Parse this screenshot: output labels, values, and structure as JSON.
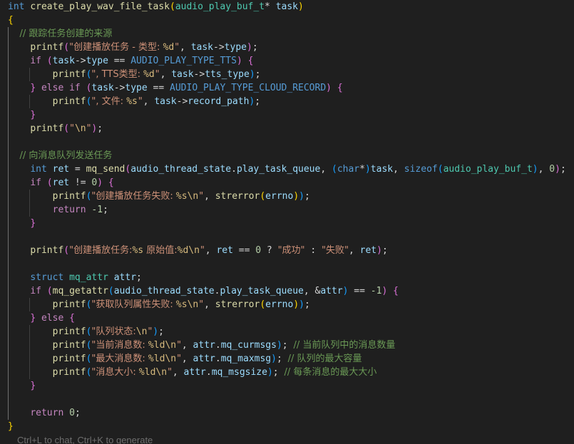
{
  "code_lines": [
    [
      [
        "int",
        "t-kw"
      ],
      [
        " ",
        "t-pun"
      ],
      [
        "create_play_wav_file_task",
        "t-fn"
      ],
      [
        "(",
        "t-b1"
      ],
      [
        "audio_play_buf_t",
        "t-type"
      ],
      [
        "* ",
        "t-pun"
      ],
      [
        "task",
        "t-var"
      ],
      [
        ")",
        "t-b1"
      ]
    ],
    [
      [
        "{",
        "t-b1"
      ]
    ],
    [
      [
        "    // 跟踪任务创建的来源",
        "t-cmt"
      ]
    ],
    [
      [
        "    ",
        "t-pun"
      ],
      [
        "printf",
        "t-fn"
      ],
      [
        "(",
        "t-b2"
      ],
      [
        "\"创建播放任务 - 类型: ",
        "t-str"
      ],
      [
        "%d",
        "t-esc"
      ],
      [
        "\"",
        "t-str"
      ],
      [
        ", ",
        "t-pun"
      ],
      [
        "task",
        "t-var"
      ],
      [
        "->",
        "t-pun"
      ],
      [
        "type",
        "t-var"
      ],
      [
        ")",
        "t-b2"
      ],
      [
        ";",
        "t-pun"
      ]
    ],
    [
      [
        "    ",
        "t-pun"
      ],
      [
        "if",
        "t-ctl"
      ],
      [
        " ",
        "t-pun"
      ],
      [
        "(",
        "t-b2"
      ],
      [
        "task",
        "t-var"
      ],
      [
        "->",
        "t-pun"
      ],
      [
        "type",
        "t-var"
      ],
      [
        " == ",
        "t-pun"
      ],
      [
        "AUDIO_PLAY_TYPE_TTS",
        "t-kw"
      ],
      [
        ")",
        "t-b2"
      ],
      [
        " ",
        "t-pun"
      ],
      [
        "{",
        "t-b2"
      ]
    ],
    [
      [
        "        ",
        "t-pun"
      ],
      [
        "printf",
        "t-fn"
      ],
      [
        "(",
        "t-b3"
      ],
      [
        "\", TTS类型: ",
        "t-str"
      ],
      [
        "%d",
        "t-esc"
      ],
      [
        "\"",
        "t-str"
      ],
      [
        ", ",
        "t-pun"
      ],
      [
        "task",
        "t-var"
      ],
      [
        "->",
        "t-pun"
      ],
      [
        "tts_type",
        "t-var"
      ],
      [
        ")",
        "t-b3"
      ],
      [
        ";",
        "t-pun"
      ]
    ],
    [
      [
        "    ",
        "t-pun"
      ],
      [
        "}",
        "t-b2"
      ],
      [
        " ",
        "t-pun"
      ],
      [
        "else",
        "t-ctl"
      ],
      [
        " ",
        "t-pun"
      ],
      [
        "if",
        "t-ctl"
      ],
      [
        " ",
        "t-pun"
      ],
      [
        "(",
        "t-b2"
      ],
      [
        "task",
        "t-var"
      ],
      [
        "->",
        "t-pun"
      ],
      [
        "type",
        "t-var"
      ],
      [
        " == ",
        "t-pun"
      ],
      [
        "AUDIO_PLAY_TYPE_CLOUD_RECORD",
        "t-kw"
      ],
      [
        ")",
        "t-b2"
      ],
      [
        " ",
        "t-pun"
      ],
      [
        "{",
        "t-b2"
      ]
    ],
    [
      [
        "        ",
        "t-pun"
      ],
      [
        "printf",
        "t-fn"
      ],
      [
        "(",
        "t-b3"
      ],
      [
        "\", 文件: ",
        "t-str"
      ],
      [
        "%s",
        "t-esc"
      ],
      [
        "\"",
        "t-str"
      ],
      [
        ", ",
        "t-pun"
      ],
      [
        "task",
        "t-var"
      ],
      [
        "->",
        "t-pun"
      ],
      [
        "record_path",
        "t-var"
      ],
      [
        ")",
        "t-b3"
      ],
      [
        ";",
        "t-pun"
      ]
    ],
    [
      [
        "    ",
        "t-pun"
      ],
      [
        "}",
        "t-b2"
      ]
    ],
    [
      [
        "    ",
        "t-pun"
      ],
      [
        "printf",
        "t-fn"
      ],
      [
        "(",
        "t-b2"
      ],
      [
        "\"",
        "t-str"
      ],
      [
        "\\n",
        "t-esc"
      ],
      [
        "\"",
        "t-str"
      ],
      [
        ")",
        "t-b2"
      ],
      [
        ";",
        "t-pun"
      ]
    ],
    [],
    [
      [
        "    // 向消息队列发送任务",
        "t-cmt"
      ]
    ],
    [
      [
        "    ",
        "t-pun"
      ],
      [
        "int",
        "t-kw"
      ],
      [
        " ",
        "t-pun"
      ],
      [
        "ret",
        "t-var"
      ],
      [
        " = ",
        "t-pun"
      ],
      [
        "mq_send",
        "t-fn"
      ],
      [
        "(",
        "t-b2"
      ],
      [
        "audio_thread_state",
        "t-var"
      ],
      [
        ".",
        "t-pun"
      ],
      [
        "play_task_queue",
        "t-var"
      ],
      [
        ", ",
        "t-pun"
      ],
      [
        "(",
        "t-b3"
      ],
      [
        "char",
        "t-kw"
      ],
      [
        "*",
        "t-pun"
      ],
      [
        ")",
        "t-b3"
      ],
      [
        "task",
        "t-var"
      ],
      [
        ", ",
        "t-pun"
      ],
      [
        "sizeof",
        "t-kw"
      ],
      [
        "(",
        "t-b3"
      ],
      [
        "audio_play_buf_t",
        "t-type"
      ],
      [
        ")",
        "t-b3"
      ],
      [
        ", ",
        "t-pun"
      ],
      [
        "0",
        "t-num"
      ],
      [
        ")",
        "t-b2"
      ],
      [
        ";",
        "t-pun"
      ]
    ],
    [
      [
        "    ",
        "t-pun"
      ],
      [
        "if",
        "t-ctl"
      ],
      [
        " ",
        "t-pun"
      ],
      [
        "(",
        "t-b2"
      ],
      [
        "ret",
        "t-var"
      ],
      [
        " != ",
        "t-pun"
      ],
      [
        "0",
        "t-num"
      ],
      [
        ")",
        "t-b2"
      ],
      [
        " ",
        "t-pun"
      ],
      [
        "{",
        "t-b2"
      ]
    ],
    [
      [
        "        ",
        "t-pun"
      ],
      [
        "printf",
        "t-fn"
      ],
      [
        "(",
        "t-b3"
      ],
      [
        "\"创建播放任务失败: ",
        "t-str"
      ],
      [
        "%s\\n",
        "t-esc"
      ],
      [
        "\"",
        "t-str"
      ],
      [
        ", ",
        "t-pun"
      ],
      [
        "strerror",
        "t-fn"
      ],
      [
        "(",
        "t-b1"
      ],
      [
        "errno",
        "t-var"
      ],
      [
        ")",
        "t-b1"
      ],
      [
        ")",
        "t-b3"
      ],
      [
        ";",
        "t-pun"
      ]
    ],
    [
      [
        "        ",
        "t-pun"
      ],
      [
        "return",
        "t-ctl"
      ],
      [
        " ",
        "t-pun"
      ],
      [
        "-1",
        "t-num"
      ],
      [
        ";",
        "t-pun"
      ]
    ],
    [
      [
        "    ",
        "t-pun"
      ],
      [
        "}",
        "t-b2"
      ]
    ],
    [],
    [
      [
        "    ",
        "t-pun"
      ],
      [
        "printf",
        "t-fn"
      ],
      [
        "(",
        "t-b2"
      ],
      [
        "\"创建播放任务:",
        "t-str"
      ],
      [
        "%s",
        "t-esc"
      ],
      [
        " 原始值:",
        "t-str"
      ],
      [
        "%d\\n",
        "t-esc"
      ],
      [
        "\"",
        "t-str"
      ],
      [
        ", ",
        "t-pun"
      ],
      [
        "ret",
        "t-var"
      ],
      [
        " == ",
        "t-pun"
      ],
      [
        "0",
        "t-num"
      ],
      [
        " ? ",
        "t-pun"
      ],
      [
        "\"成功\"",
        "t-str"
      ],
      [
        " : ",
        "t-pun"
      ],
      [
        "\"失败\"",
        "t-str"
      ],
      [
        ", ",
        "t-pun"
      ],
      [
        "ret",
        "t-var"
      ],
      [
        ")",
        "t-b2"
      ],
      [
        ";",
        "t-pun"
      ]
    ],
    [],
    [
      [
        "    ",
        "t-pun"
      ],
      [
        "struct",
        "t-kw"
      ],
      [
        " ",
        "t-pun"
      ],
      [
        "mq_attr",
        "t-type"
      ],
      [
        " ",
        "t-pun"
      ],
      [
        "attr",
        "t-var"
      ],
      [
        ";",
        "t-pun"
      ]
    ],
    [
      [
        "    ",
        "t-pun"
      ],
      [
        "if",
        "t-ctl"
      ],
      [
        " ",
        "t-pun"
      ],
      [
        "(",
        "t-b2"
      ],
      [
        "mq_getattr",
        "t-fn"
      ],
      [
        "(",
        "t-b3"
      ],
      [
        "audio_thread_state",
        "t-var"
      ],
      [
        ".",
        "t-pun"
      ],
      [
        "play_task_queue",
        "t-var"
      ],
      [
        ", &",
        "t-pun"
      ],
      [
        "attr",
        "t-var"
      ],
      [
        ")",
        "t-b3"
      ],
      [
        " == ",
        "t-pun"
      ],
      [
        "-1",
        "t-num"
      ],
      [
        ")",
        "t-b2"
      ],
      [
        " ",
        "t-pun"
      ],
      [
        "{",
        "t-b2"
      ]
    ],
    [
      [
        "        ",
        "t-pun"
      ],
      [
        "printf",
        "t-fn"
      ],
      [
        "(",
        "t-b3"
      ],
      [
        "\"获取队列属性失败: ",
        "t-str"
      ],
      [
        "%s\\n",
        "t-esc"
      ],
      [
        "\"",
        "t-str"
      ],
      [
        ", ",
        "t-pun"
      ],
      [
        "strerror",
        "t-fn"
      ],
      [
        "(",
        "t-b1"
      ],
      [
        "errno",
        "t-var"
      ],
      [
        ")",
        "t-b1"
      ],
      [
        ")",
        "t-b3"
      ],
      [
        ";",
        "t-pun"
      ]
    ],
    [
      [
        "    ",
        "t-pun"
      ],
      [
        "}",
        "t-b2"
      ],
      [
        " ",
        "t-pun"
      ],
      [
        "else",
        "t-ctl"
      ],
      [
        " ",
        "t-pun"
      ],
      [
        "{",
        "t-b2"
      ]
    ],
    [
      [
        "        ",
        "t-pun"
      ],
      [
        "printf",
        "t-fn"
      ],
      [
        "(",
        "t-b3"
      ],
      [
        "\"队列状态:",
        "t-str"
      ],
      [
        "\\n",
        "t-esc"
      ],
      [
        "\"",
        "t-str"
      ],
      [
        ")",
        "t-b3"
      ],
      [
        ";",
        "t-pun"
      ]
    ],
    [
      [
        "        ",
        "t-pun"
      ],
      [
        "printf",
        "t-fn"
      ],
      [
        "(",
        "t-b3"
      ],
      [
        "\"当前消息数: ",
        "t-str"
      ],
      [
        "%ld\\n",
        "t-esc"
      ],
      [
        "\"",
        "t-str"
      ],
      [
        ", ",
        "t-pun"
      ],
      [
        "attr",
        "t-var"
      ],
      [
        ".",
        "t-pun"
      ],
      [
        "mq_curmsgs",
        "t-var"
      ],
      [
        ")",
        "t-b3"
      ],
      [
        "; ",
        "t-pun"
      ],
      [
        "// 当前队列中的消息数量",
        "t-cmt"
      ]
    ],
    [
      [
        "        ",
        "t-pun"
      ],
      [
        "printf",
        "t-fn"
      ],
      [
        "(",
        "t-b3"
      ],
      [
        "\"最大消息数: ",
        "t-str"
      ],
      [
        "%ld\\n",
        "t-esc"
      ],
      [
        "\"",
        "t-str"
      ],
      [
        ", ",
        "t-pun"
      ],
      [
        "attr",
        "t-var"
      ],
      [
        ".",
        "t-pun"
      ],
      [
        "mq_maxmsg",
        "t-var"
      ],
      [
        ")",
        "t-b3"
      ],
      [
        "; ",
        "t-pun"
      ],
      [
        "// 队列的最大容量",
        "t-cmt"
      ]
    ],
    [
      [
        "        ",
        "t-pun"
      ],
      [
        "printf",
        "t-fn"
      ],
      [
        "(",
        "t-b3"
      ],
      [
        "\"消息大小: ",
        "t-str"
      ],
      [
        "%ld\\n",
        "t-esc"
      ],
      [
        "\"",
        "t-str"
      ],
      [
        ", ",
        "t-pun"
      ],
      [
        "attr",
        "t-var"
      ],
      [
        ".",
        "t-pun"
      ],
      [
        "mq_msgsize",
        "t-var"
      ],
      [
        ")",
        "t-b3"
      ],
      [
        "; ",
        "t-pun"
      ],
      [
        "// 每条消息的最大大小",
        "t-cmt"
      ]
    ],
    [
      [
        "    ",
        "t-pun"
      ],
      [
        "}",
        "t-b2"
      ]
    ],
    [],
    [
      [
        "    ",
        "t-pun"
      ],
      [
        "return",
        "t-ctl"
      ],
      [
        " ",
        "t-pun"
      ],
      [
        "0",
        "t-num"
      ],
      [
        ";",
        "t-pun"
      ]
    ],
    [
      [
        "}",
        "t-b1"
      ]
    ]
  ],
  "inline_hint": "Ctrl+L to chat, Ctrl+K to generate",
  "colors": {
    "background": "#1f1f1f",
    "keyword": "#569cd6",
    "control": "#c586c0",
    "function": "#dcdcaa",
    "variable": "#9cdcfe",
    "type": "#4ec9b0",
    "string": "#ce9178",
    "escape": "#d7ba7d",
    "number": "#b5cea8",
    "comment": "#6a9955",
    "bracket_level_1": "#ffd700",
    "bracket_level_2": "#da70d6",
    "bracket_level_3": "#179fff"
  }
}
